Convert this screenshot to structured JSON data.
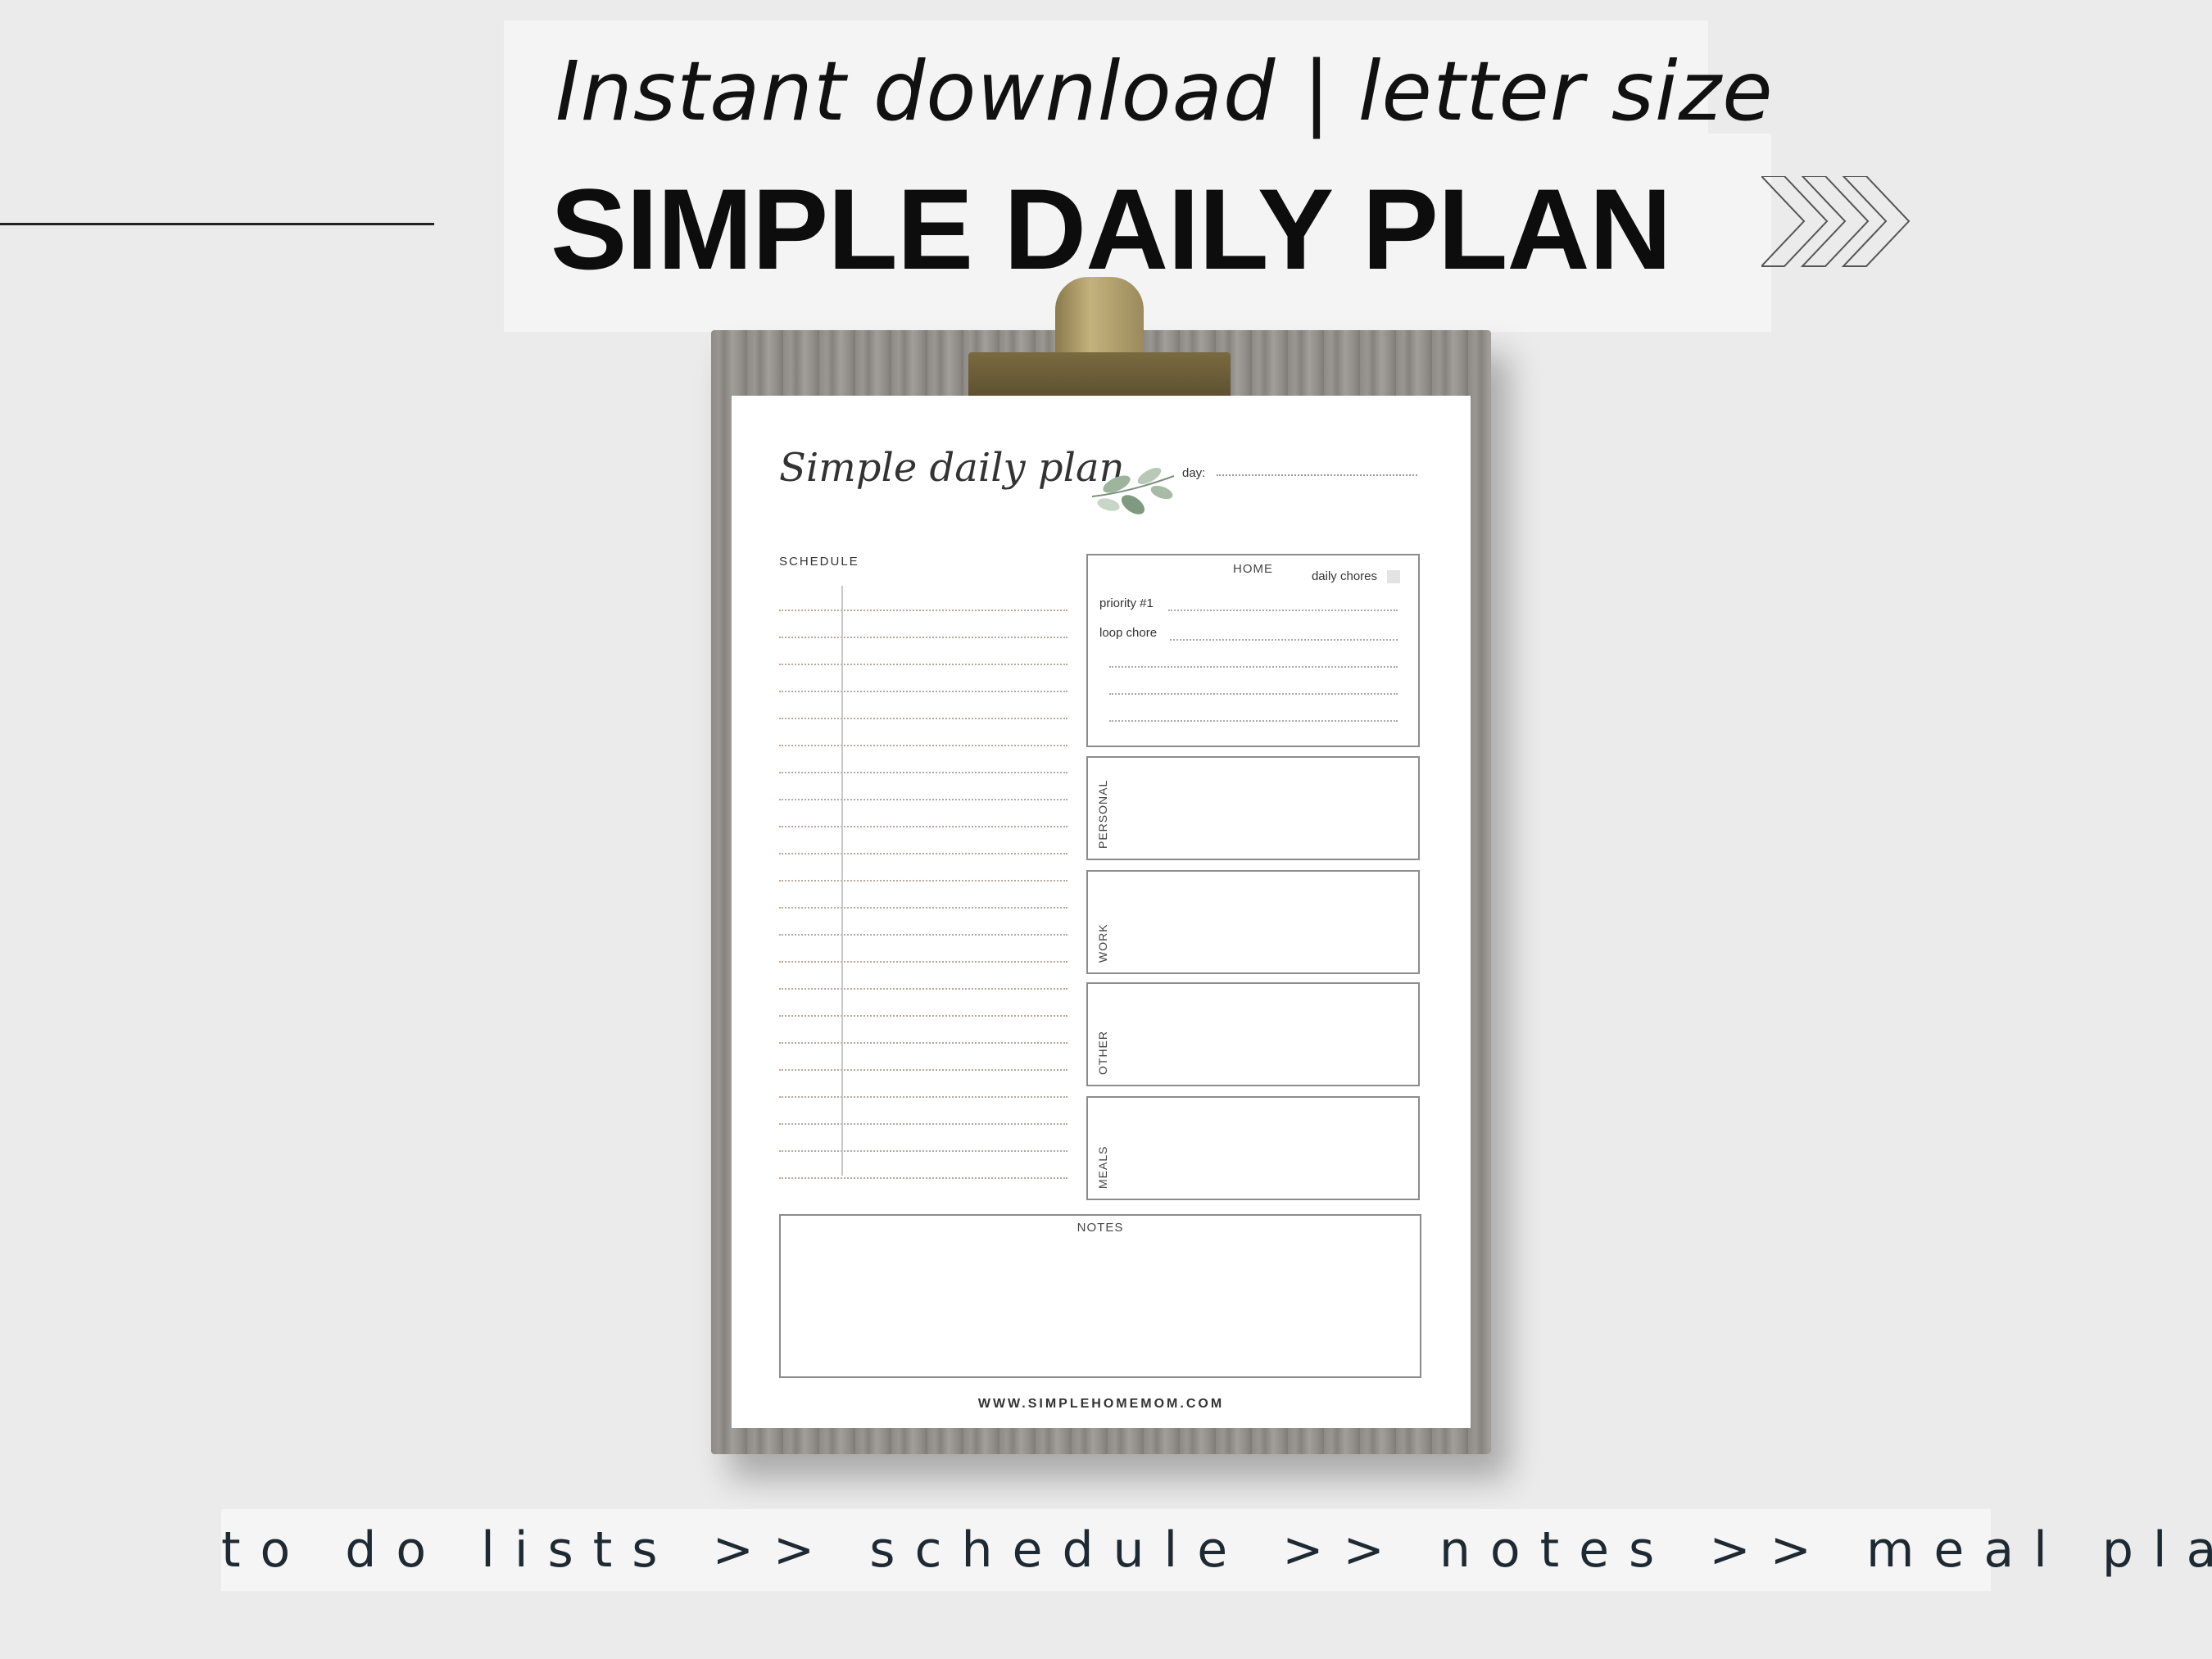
{
  "header": {
    "subtitle": "Instant download | letter size",
    "title": "SIMPLE DAILY PLAN"
  },
  "planner": {
    "script_title": "Simple daily plan",
    "day_label": "day:",
    "schedule_title": "SCHEDULE",
    "schedule_line_count": 22,
    "home": {
      "title": "HOME",
      "daily_chores": "daily chores",
      "priority": "priority #1",
      "loop_chore": "loop chore"
    },
    "sections": [
      "PERSONAL",
      "WORK",
      "OTHER",
      "MEALS"
    ],
    "notes_title": "NOTES",
    "website": "WWW.SIMPLEHOMEMOM.COM"
  },
  "footer": {
    "tagline": "to do lists >> schedule >> notes >> meal plan"
  },
  "colors": {
    "background": "#ebebeb",
    "banner": "#f4f4f4",
    "text_dark": "#111111",
    "tagline": "#1e2a33",
    "leaf_green": "#8fa890"
  }
}
